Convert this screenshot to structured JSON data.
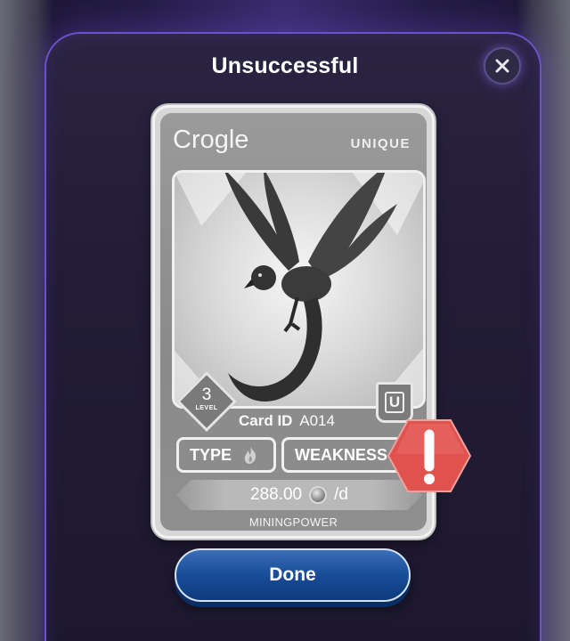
{
  "modal": {
    "title": "Unsuccessful",
    "close_icon": "close-icon"
  },
  "card": {
    "name": "Crogle",
    "rarity": "UNIQUE",
    "level": "3",
    "level_label": "LEVEL",
    "rarity_badge": "U",
    "card_id_label": "Card ID",
    "card_id_value": "A014",
    "type_label": "TYPE",
    "type_icon": "fire-icon",
    "weakness_label": "WEAKNESS",
    "mining_value": "288.00",
    "mining_unit": "/d",
    "mining_label": "MININGPOWER"
  },
  "alert": {
    "icon": "warning-icon",
    "color": "#e0524d"
  },
  "actions": {
    "done_label": "Done"
  }
}
